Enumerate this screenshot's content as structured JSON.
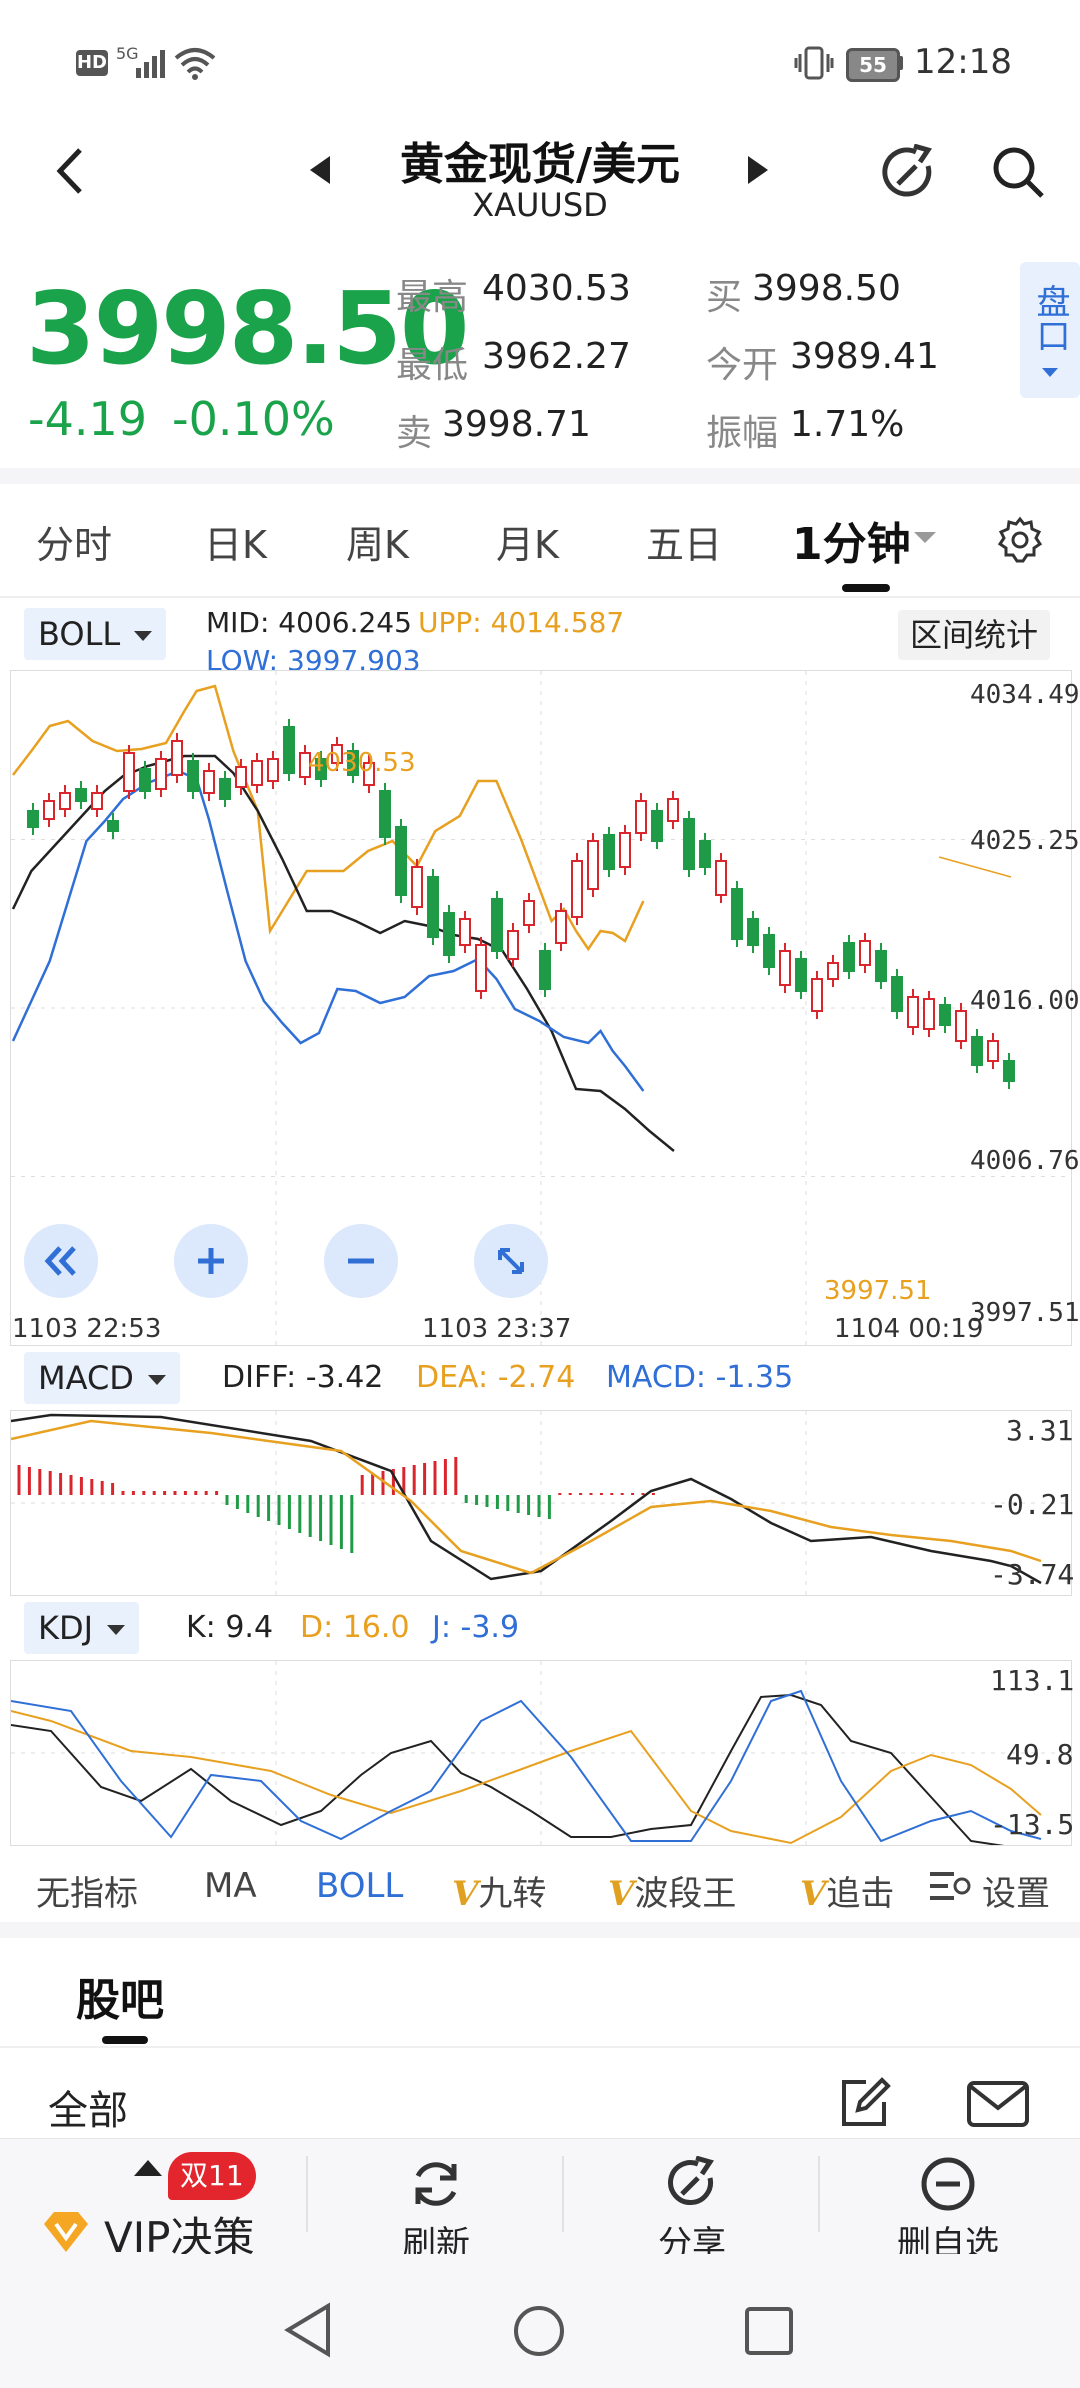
{
  "status": {
    "left_icons": [
      "hd-icon",
      "5g-signal-icon",
      "wifi-icon"
    ],
    "hd": "HD",
    "net": "5G",
    "battery": "55",
    "time": "12:18"
  },
  "header": {
    "title": "黄金现货/美元",
    "subtitle": "XAUUSD"
  },
  "quote": {
    "price": "3998.50",
    "change": "-4.19",
    "change_pct": "-0.10%",
    "color": "#1aa34a",
    "high_label": "最高",
    "high": "4030.53",
    "low_label": "最低",
    "low": "3962.27",
    "sell_label": "卖",
    "sell": "3998.71",
    "buy_label": "买",
    "buy": "3998.50",
    "open_label": "今开",
    "open": "3989.41",
    "amp_label": "振幅",
    "amp": "1.71%",
    "pankou": "盘口"
  },
  "tabs": [
    "分时",
    "日K",
    "周K",
    "月K",
    "五日",
    "1分钟"
  ],
  "active_tab": "1分钟",
  "boll": {
    "name": "BOLL",
    "mid": "MID: 4006.245",
    "upp": "UPP: 4014.587",
    "low": "LOW: 3997.903",
    "range_btn": "区间统计",
    "y_labels": [
      "4034.49",
      "4025.25",
      "4016.00",
      "4006.76",
      "3997.51"
    ],
    "peak_label": "4030.53",
    "last_label": "3997.51",
    "time_labels": [
      "1103  22:53",
      "1103  23:37",
      "1104  00:19"
    ],
    "colors": {
      "mid": "#222222",
      "upp": "#e8a020",
      "low": "#2f6fd6",
      "up": "#d9262c",
      "down": "#1f9a46"
    }
  },
  "macd": {
    "name": "MACD",
    "diff": "DIFF: -3.42",
    "dea": "DEA: -2.74",
    "macd": "MACD: -1.35",
    "y_labels": [
      "3.31",
      "-0.21",
      "-3.74"
    ]
  },
  "kdj": {
    "name": "KDJ",
    "k": "K: 9.4",
    "d": "D: 16.0",
    "j": "J: -3.9",
    "y_labels": [
      "113.1",
      "49.8",
      "-13.5"
    ]
  },
  "indicators": [
    {
      "v": "",
      "label": "无指标"
    },
    {
      "v": "",
      "label": "MA"
    },
    {
      "v": "",
      "label": "BOLL"
    },
    {
      "v": "V",
      "label": "九转"
    },
    {
      "v": "V",
      "label": "波段王"
    },
    {
      "v": "V",
      "label": "追击"
    }
  ],
  "settings_label": "设置",
  "forum": {
    "title": "股吧",
    "filter": "全部"
  },
  "bottom": {
    "vip": "VIP决策",
    "badge": "双11",
    "refresh": "刷新",
    "share": "分享",
    "remove": "删自选"
  }
}
